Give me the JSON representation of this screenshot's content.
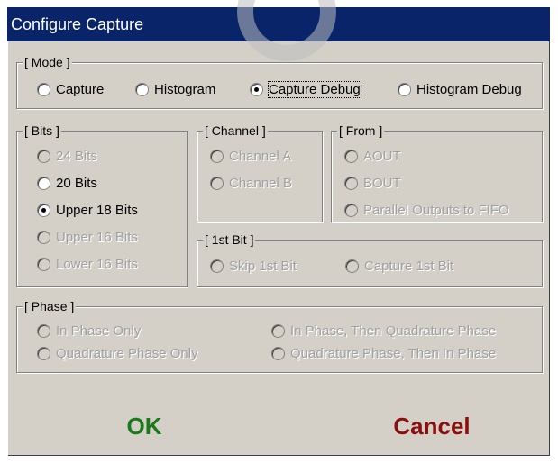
{
  "window": {
    "title": "Configure Capture"
  },
  "colors": {
    "titlebar": "#0a246a",
    "ok": "#1a7a1a",
    "cancel": "#8a1010",
    "disabled": "#a0a0a0"
  },
  "mode": {
    "legend": "[ Mode ]",
    "options": [
      "Capture",
      "Histogram",
      "Capture Debug",
      "Histogram Debug"
    ],
    "selected": "Capture Debug"
  },
  "bits": {
    "legend": "[ Bits ]",
    "options": [
      "24 Bits",
      "20 Bits",
      "Upper 18 Bits",
      "Upper 16 Bits",
      "Lower 16 Bits"
    ],
    "selected": "Upper 18 Bits"
  },
  "channel": {
    "legend": "[ Channel ]",
    "options": [
      "Channel A",
      "Channel B"
    ]
  },
  "from": {
    "legend": "[ From ]",
    "options": [
      "AOUT",
      "BOUT",
      "Parallel Outputs to FIFO"
    ]
  },
  "first_bit": {
    "legend": "[ 1st Bit ]",
    "options": [
      "Skip 1st Bit",
      "Capture 1st Bit"
    ]
  },
  "phase": {
    "legend": "[ Phase ]",
    "options": [
      "In Phase Only",
      "In Phase, Then Quadrature Phase",
      "Quadrature Phase Only",
      "Quadrature Phase, Then In Phase"
    ]
  },
  "buttons": {
    "ok": "OK",
    "cancel": "Cancel"
  }
}
